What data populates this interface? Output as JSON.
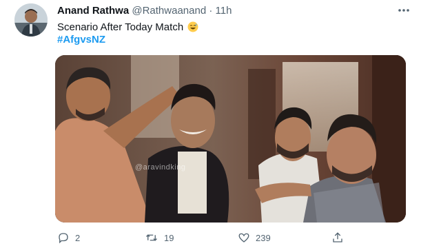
{
  "tweet": {
    "author_name": "Anand Rathwa",
    "handle": "@Rathwaanand",
    "separator": "·",
    "time": "11h",
    "text": "Scenario After Today Match",
    "emoji": "sweat-smile-emoji",
    "hashtag": "#AfgvsNZ",
    "media": {
      "watermark": "@aravindking",
      "description_icons": [
        "avatar-photo",
        "meme-image"
      ]
    },
    "actions": {
      "reply_count": "2",
      "retweet_count": "19",
      "like_count": "239"
    },
    "colors": {
      "link": "#1d9bf0",
      "secondary_text": "#536471",
      "primary_text": "#0f1419"
    }
  }
}
